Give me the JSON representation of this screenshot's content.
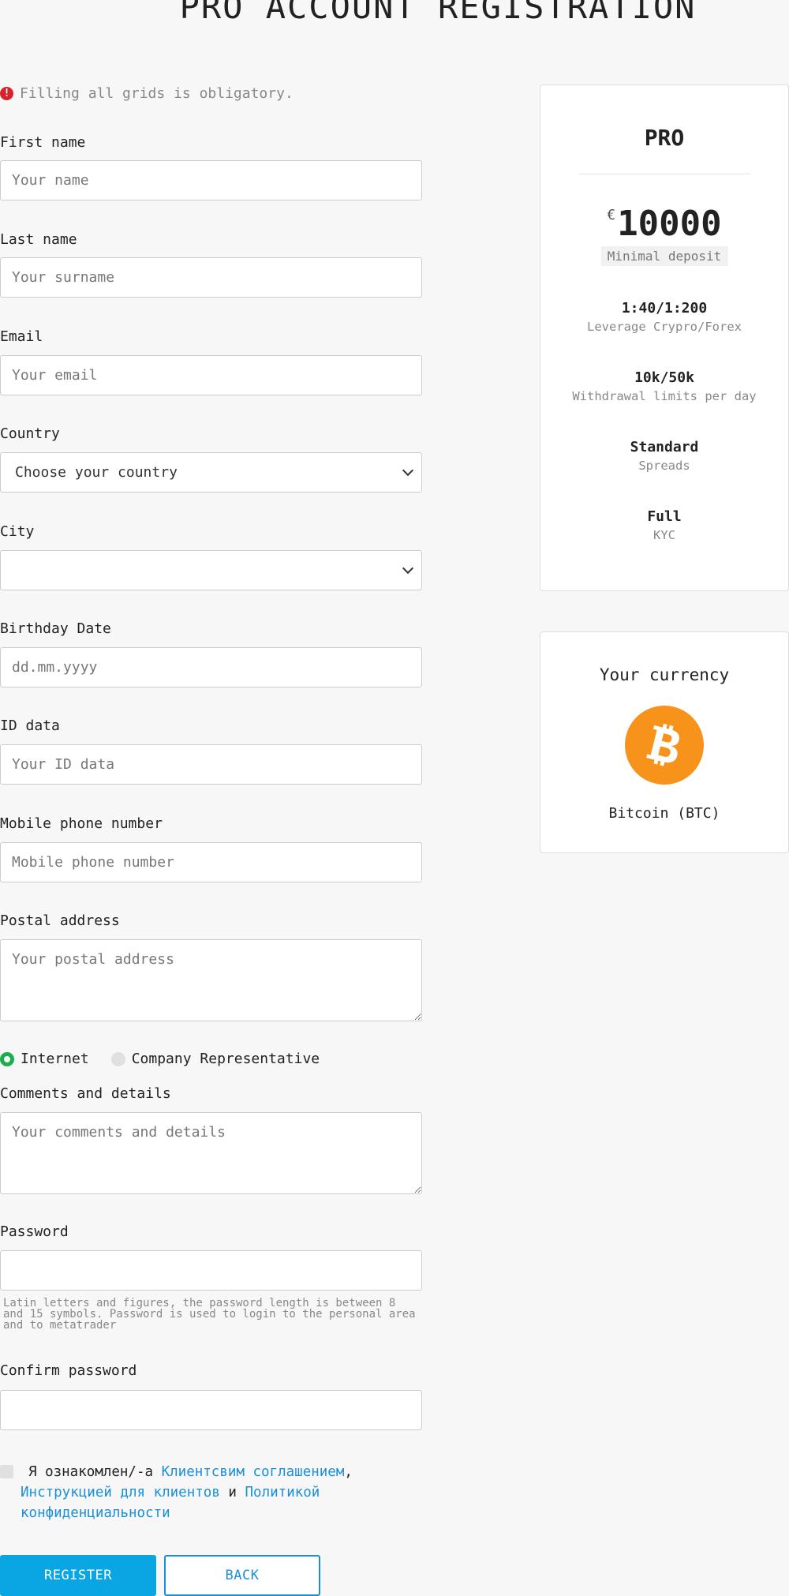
{
  "page": {
    "title": "PRO ACCOUNT REGISTRATION",
    "notice": "Filling all grids is obligatory."
  },
  "form": {
    "first_name": {
      "label": "First name",
      "placeholder": "Your name"
    },
    "last_name": {
      "label": "Last name",
      "placeholder": "Your surname"
    },
    "email": {
      "label": "Email",
      "placeholder": "Your email"
    },
    "country": {
      "label": "Country",
      "value": "Choose your country"
    },
    "city": {
      "label": "City",
      "value": ""
    },
    "birthday": {
      "label": "Birthday Date",
      "placeholder": "dd.mm.yyyy"
    },
    "id_data": {
      "label": "ID data",
      "placeholder": "Your ID data"
    },
    "phone": {
      "label": "Mobile phone number",
      "placeholder": "Mobile phone number"
    },
    "postal": {
      "label": "Postal address",
      "placeholder": "Your postal address"
    },
    "source": {
      "options": [
        {
          "label": "Internet",
          "checked": true
        },
        {
          "label": "Company Representative",
          "checked": false
        }
      ]
    },
    "comments": {
      "label": "Comments and details",
      "placeholder": "Your comments and details"
    },
    "password": {
      "label": "Password",
      "hint": "Latin letters and figures, the password length is between 8 and 15 symbols. Password is used to login to the personal area and to metatrader"
    },
    "confirm_password": {
      "label": "Confirm password"
    },
    "agreement": {
      "prefix": "Я ознакомлен/-а",
      "link1": "Клиентсвим соглашением",
      "comma": ",",
      "link2": "Инструкцией для клиентов",
      "and": "и",
      "link3_a": "Политикой",
      "link3_b": "конфиденциальности"
    },
    "register_label": "REGISTER",
    "back_label": "BACK"
  },
  "plan": {
    "name": "PRO",
    "currency_symbol": "€",
    "amount": "10000",
    "amount_label": "Minimal deposit",
    "specs": [
      {
        "value": "1:40/1:200",
        "label": "Leverage Crypro/Forex"
      },
      {
        "value": "10k/50k",
        "label": "Withdrawal limits per day"
      },
      {
        "value": "Standard",
        "label": "Spreads"
      },
      {
        "value": "Full",
        "label": "KYC"
      }
    ]
  },
  "currency": {
    "title": "Your currency",
    "icon": "bitcoin-icon",
    "brand_color": "#f7931a",
    "name": "Bitcoin (BTC)"
  }
}
